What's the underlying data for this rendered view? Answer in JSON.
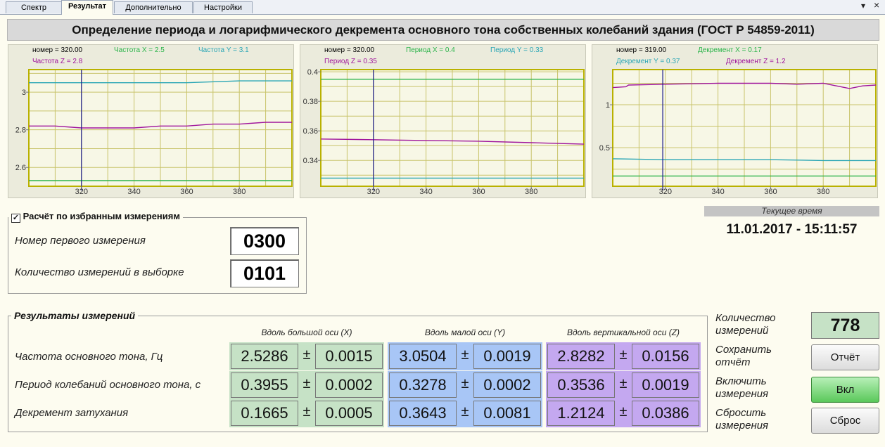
{
  "tabs": [
    "Спектр",
    "Результат",
    "Дополнительно",
    "Настройки"
  ],
  "window_controls": {
    "menu": "▾",
    "close": "×"
  },
  "title": "Определение периода и логарифмического декремента основного тона собственных колебаний здания (ГОСТ Р 54859-2011)",
  "chart_data": [
    {
      "type": "line",
      "legend": [
        "номер = 320.00",
        "Частота X = 2.5",
        "Частота Y = 3.1",
        "Частота Z = 2.8"
      ],
      "x_ticks": [
        "320",
        "340",
        "360",
        "380"
      ],
      "y_ticks": [
        "3",
        "2.8",
        "2.6"
      ],
      "xlim": [
        300,
        400
      ],
      "ylim": [
        2.5,
        3.12
      ],
      "cursor_x": 320,
      "grid": true,
      "series": [
        {
          "color": "#2aa6b5",
          "x": [
            300,
            326,
            360,
            380,
            400
          ],
          "y": [
            3.05,
            3.05,
            3.05,
            3.06,
            3.06
          ]
        },
        {
          "color": "#a0159c",
          "x": [
            300,
            310,
            320,
            340,
            350,
            360,
            370,
            380,
            390,
            400
          ],
          "y": [
            2.82,
            2.82,
            2.81,
            2.81,
            2.82,
            2.82,
            2.83,
            2.83,
            2.84,
            2.84
          ]
        },
        {
          "color": "#2bb44a",
          "x": [
            300,
            320,
            340,
            360,
            380,
            400
          ],
          "y": [
            2.53,
            2.53,
            2.53,
            2.53,
            2.53,
            2.53
          ]
        }
      ]
    },
    {
      "type": "line",
      "legend": [
        "номер = 320.00",
        "Период X = 0.4",
        "Период Y = 0.33",
        "Период Z = 0.35"
      ],
      "x_ticks": [
        "320",
        "340",
        "360",
        "380"
      ],
      "y_ticks": [
        "0.4",
        "0.38",
        "0.36",
        "0.34"
      ],
      "xlim": [
        300,
        400
      ],
      "ylim": [
        0.3225,
        0.4015
      ],
      "cursor_x": 320,
      "grid": true,
      "series": [
        {
          "color": "#2bb44a",
          "x": [
            300,
            320,
            340,
            360,
            380,
            400
          ],
          "y": [
            0.395,
            0.395,
            0.395,
            0.395,
            0.395,
            0.395
          ]
        },
        {
          "color": "#a0159c",
          "x": [
            300,
            320,
            340,
            360,
            380,
            390,
            400
          ],
          "y": [
            0.3545,
            0.354,
            0.3535,
            0.353,
            0.352,
            0.3515,
            0.351
          ]
        },
        {
          "color": "#2aa6b5",
          "x": [
            300,
            320,
            340,
            360,
            380,
            400
          ],
          "y": [
            0.328,
            0.328,
            0.328,
            0.328,
            0.328,
            0.328
          ]
        }
      ]
    },
    {
      "type": "line",
      "legend": [
        "номер = 319.00",
        "Декремент X = 0.17",
        "Декремент Y = 0.37",
        "Декремент Z = 1.2"
      ],
      "x_ticks": [
        "320",
        "340",
        "360",
        "380"
      ],
      "y_ticks": [
        "1",
        "0.5"
      ],
      "xlim": [
        300,
        400
      ],
      "ylim": [
        0.05,
        1.41
      ],
      "cursor_x": 319,
      "grid": true,
      "series": [
        {
          "color": "#a0159c",
          "x": [
            300,
            305,
            306,
            320,
            340,
            360,
            370,
            380,
            385,
            390,
            395,
            400
          ],
          "y": [
            1.2,
            1.21,
            1.23,
            1.24,
            1.25,
            1.25,
            1.24,
            1.25,
            1.22,
            1.19,
            1.22,
            1.23
          ]
        },
        {
          "color": "#2aa6b5",
          "x": [
            300,
            320,
            340,
            360,
            380,
            400
          ],
          "y": [
            0.37,
            0.36,
            0.36,
            0.36,
            0.35,
            0.35
          ]
        },
        {
          "color": "#2bb44a",
          "x": [
            300,
            320,
            340,
            360,
            380,
            400
          ],
          "y": [
            0.17,
            0.17,
            0.17,
            0.17,
            0.17,
            0.17
          ]
        }
      ]
    }
  ],
  "selection": {
    "checkbox_label": "Расчёт по избранным измерениям",
    "checked": true,
    "first_label": "Номер первого измерения",
    "first_value": "0300",
    "count_label": "Количество измерений в выборке",
    "count_value": "0101"
  },
  "clock": {
    "label": "Текущее время",
    "value": "11.01.2017 - 15:11:57"
  },
  "results": {
    "title": "Результаты измерений",
    "columns": [
      "Вдоль большой оси (X)",
      "Вдоль малой оси (Y)",
      "Вдоль вертикальной оси (Z)"
    ],
    "column_colors": [
      "#c6e2c6",
      "#a8c6f6",
      "#c4a8f0"
    ],
    "pm": "±",
    "rows": [
      {
        "label": "Частота основного тона, Гц",
        "values": [
          [
            "2.5286",
            "0.0015"
          ],
          [
            "3.0504",
            "0.0019"
          ],
          [
            "2.8282",
            "0.0156"
          ]
        ]
      },
      {
        "label": "Период колебаний основного тона, с",
        "values": [
          [
            "0.3955",
            "0.0002"
          ],
          [
            "0.3278",
            "0.0002"
          ],
          [
            "0.3536",
            "0.0019"
          ]
        ]
      },
      {
        "label": "Декремент затухания",
        "values": [
          [
            "0.1665",
            "0.0005"
          ],
          [
            "0.3643",
            "0.0081"
          ],
          [
            "1.2124",
            "0.0386"
          ]
        ]
      }
    ]
  },
  "right_panel": {
    "count_label": "Количество измерений",
    "count_value": "778",
    "save_label": "Сохранить отчёт",
    "save_button": "Отчёт",
    "enable_label": "Включить измерения",
    "enable_button": "Вкл",
    "reset_label": "Сбросить измерения",
    "reset_button": "Сброс"
  }
}
